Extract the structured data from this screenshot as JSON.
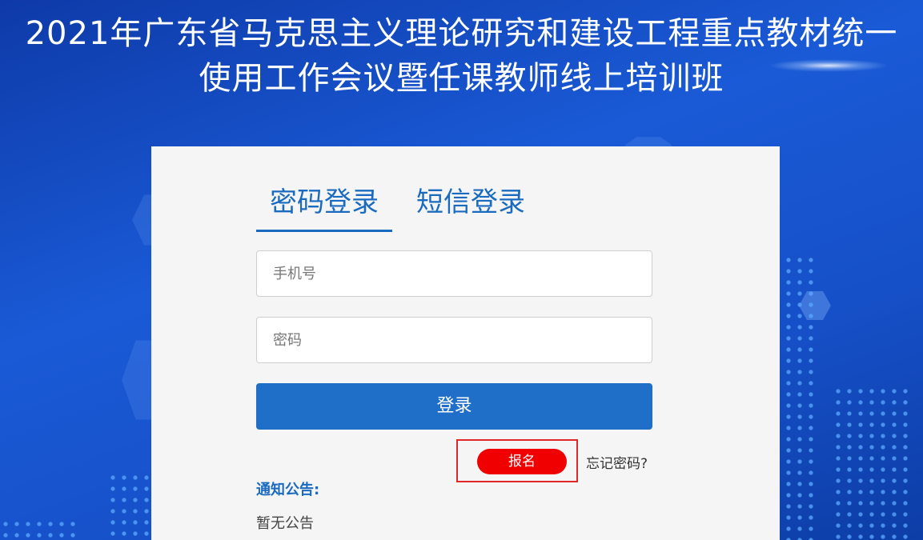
{
  "header": {
    "title_line1": "2021年广东省马克思主义理论研究和建设工程重点教材统一",
    "title_line2": "使用工作会议暨任课教师线上培训班"
  },
  "login": {
    "tabs": [
      {
        "label": "密码登录",
        "active": true
      },
      {
        "label": "短信登录",
        "active": false
      }
    ],
    "phone_placeholder": "手机号",
    "password_placeholder": "密码",
    "login_button": "登录",
    "signup_button": "报名",
    "forgot_link": "忘记密码?"
  },
  "notice": {
    "title": "通知公告:",
    "text": "暂无公告"
  },
  "colors": {
    "accent": "#1a6bbf",
    "button": "#1f6fc9",
    "signup": "#f00000",
    "highlight_border": "#e02828"
  }
}
